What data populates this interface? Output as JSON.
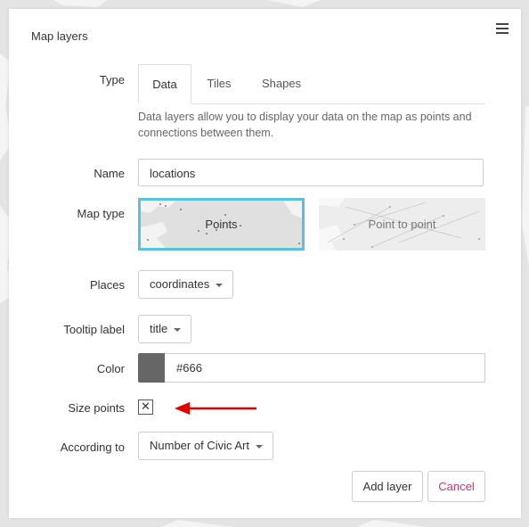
{
  "panel": {
    "title": "Map layers"
  },
  "type_row": {
    "label": "Type",
    "tabs": [
      {
        "label": "Data",
        "active": true
      },
      {
        "label": "Tiles",
        "active": false
      },
      {
        "label": "Shapes",
        "active": false
      }
    ]
  },
  "description": "Data layers allow you to display your data on the map as points and connections between them.",
  "name_row": {
    "label": "Name",
    "value": "locations"
  },
  "map_type_row": {
    "label": "Map type",
    "options": [
      {
        "label": "Points",
        "selected": true
      },
      {
        "label": "Point to point",
        "selected": false
      }
    ]
  },
  "places_row": {
    "label": "Places",
    "value": "coordinates"
  },
  "tooltip_row": {
    "label": "Tooltip label",
    "value": "title"
  },
  "color_row": {
    "label": "Color",
    "value": "#666",
    "swatch": "#666666"
  },
  "size_points_row": {
    "label": "Size points",
    "checked": true,
    "mark": "✕"
  },
  "according_row": {
    "label": "According to",
    "value": "Number of Civic Art"
  },
  "buttons": {
    "add": "Add layer",
    "cancel": "Cancel"
  },
  "colors": {
    "accent_selected": "#5bc0de",
    "cancel_text": "#d6336c",
    "annotation_arrow": "#e00000"
  }
}
